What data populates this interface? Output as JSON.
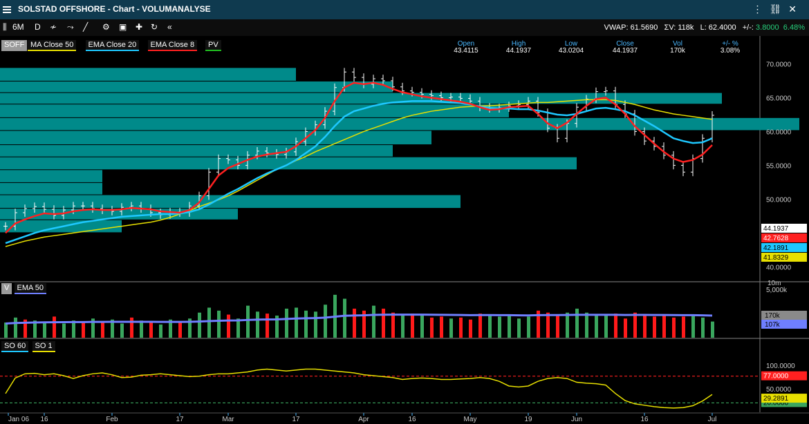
{
  "window": {
    "title": "SOLSTAD OFFSHORE - Chart - VOLUMANALYSE"
  },
  "toolbar": {
    "period": "6M",
    "interval": "D",
    "collapse": "«"
  },
  "stats": {
    "vwap": "VWAP: 61.5690",
    "sum_vol": "ΣV: 118k",
    "last": "L: 62.4000",
    "change_label": "+/-:",
    "change": "3.8000",
    "change_pct": "6.48%"
  },
  "ohlc": {
    "labels": [
      "Open",
      "High",
      "Low",
      "Close",
      "Vol",
      "+/- %"
    ],
    "values": [
      "43.4115",
      "44.1937",
      "43.0204",
      "44.1937",
      "170k",
      "3.08%"
    ]
  },
  "legend_price": [
    {
      "label": "SOFF",
      "color": "#9a9a9a",
      "fill": true
    },
    {
      "label": "MA Close 50",
      "color": "#e8e000"
    },
    {
      "label": "EMA Close 20",
      "color": "#1ec8ff"
    },
    {
      "label": "EMA Close 8",
      "color": "#ff2020"
    },
    {
      "label": "PV",
      "color": "#20c020"
    }
  ],
  "legend_vol": [
    {
      "label": "V",
      "color": "#9a9a9a",
      "fill": true
    },
    {
      "label": "EMA 50",
      "color": "#6f7fff"
    }
  ],
  "legend_so": [
    {
      "label": "SO 60",
      "color": "#1ec8ff"
    },
    {
      "label": "SO 1",
      "color": "#e8e000"
    }
  ],
  "colors": {
    "accent": "#0f3a4f",
    "profile": "#008a8a",
    "ma50": "#e8e000",
    "ema20": "#1ec8ff",
    "ema8": "#ff2020",
    "vol_up": "#3aa65e",
    "vol_down": "#ff1a1a",
    "vol_ema": "#6f7fff",
    "so": "#e8e000",
    "so_upper": "#ff2020",
    "so_lower": "#3aa65e"
  },
  "chart_data": [
    {
      "type": "line",
      "panel": "price",
      "ylim": [
        38.2,
        72.5
      ],
      "y_ticks": [
        "70.0000",
        "65.0000",
        "60.0000",
        "55.0000",
        "50.0000",
        "40.0000"
      ],
      "x_ticks": [
        "Jan 06",
        "16",
        "Feb",
        "17",
        "Mar",
        "17",
        "Apr",
        "16",
        "May",
        "19",
        "Jun",
        "16",
        "Jul"
      ],
      "price_tags": [
        {
          "value": "44.1937",
          "bg": "#ffffff",
          "fg": "#000000"
        },
        {
          "value": "42.7628",
          "bg": "#ff2020",
          "fg": "#ffffff"
        },
        {
          "value": "42.1891",
          "bg": "#1ec8ff",
          "fg": "#000000"
        },
        {
          "value": "41.8329",
          "bg": "#e8e000",
          "fg": "#000000"
        }
      ],
      "price_close": [
        46.0,
        48.0,
        48.6,
        48.9,
        48.5,
        47.6,
        48.4,
        49.0,
        49.0,
        48.6,
        48.4,
        48.2,
        48.8,
        49.0,
        48.6,
        48.0,
        47.7,
        48.1,
        48.0,
        49.0,
        50.5,
        54.0,
        56.0,
        55.8,
        55.0,
        56.5,
        57.1,
        56.8,
        56.6,
        57.0,
        58.5,
        60.0,
        61.0,
        63.0,
        66.5,
        68.8,
        68.0,
        67.0,
        67.8,
        67.5,
        66.6,
        66.0,
        65.8,
        65.5,
        65.3,
        65.0,
        65.1,
        64.9,
        64.5,
        63.6,
        63.4,
        63.5,
        63.8,
        64.0,
        64.5,
        62.8,
        60.5,
        59.0,
        61.2,
        63.6,
        64.8,
        65.9,
        66.0,
        64.0,
        62.6,
        60.0,
        58.6,
        57.8,
        56.5,
        55.0,
        54.0,
        56.0,
        59.0,
        62.4
      ],
      "series": [
        {
          "key": "ma50",
          "values": [
            43.0,
            43.4,
            43.8,
            44.1,
            44.4,
            44.6,
            44.8,
            45.0,
            45.2,
            45.4,
            45.6,
            45.8,
            46.0,
            46.2,
            46.4,
            46.6,
            46.9,
            47.3,
            47.8,
            48.3,
            48.9,
            49.4,
            49.9,
            50.5,
            51.2,
            52.0,
            52.8,
            53.6,
            54.4,
            55.0,
            55.7,
            56.3,
            57.0,
            57.6,
            58.2,
            58.8,
            59.4,
            60.0,
            60.5,
            61.0,
            61.5,
            62.0,
            62.4,
            62.7,
            63.0,
            63.2,
            63.4,
            63.6,
            63.7,
            63.8,
            63.8,
            63.9,
            64.0,
            64.1,
            64.2,
            64.3,
            64.3,
            64.4,
            64.5,
            64.6,
            64.7,
            64.7,
            64.7,
            64.6,
            64.3,
            64.0,
            63.6,
            63.2,
            62.9,
            62.6,
            62.4,
            62.2,
            62.0,
            61.8
          ]
        },
        {
          "key": "ema20",
          "values": [
            43.5,
            44.0,
            44.5,
            45.0,
            45.4,
            45.7,
            46.0,
            46.3,
            46.6,
            46.8,
            47.0,
            47.2,
            47.4,
            47.5,
            47.6,
            47.7,
            47.8,
            47.8,
            47.9,
            48.1,
            48.5,
            49.2,
            50.0,
            50.8,
            51.5,
            52.3,
            53.1,
            53.8,
            54.4,
            55.0,
            55.8,
            56.8,
            57.8,
            59.2,
            60.8,
            62.2,
            63.0,
            63.4,
            63.8,
            64.1,
            64.3,
            64.4,
            64.5,
            64.5,
            64.5,
            64.4,
            64.3,
            64.2,
            64.0,
            63.7,
            63.5,
            63.4,
            63.4,
            63.3,
            63.3,
            63.1,
            62.8,
            62.5,
            62.4,
            62.6,
            63.0,
            63.4,
            63.5,
            63.3,
            63.0,
            62.4,
            61.6,
            60.8,
            59.9,
            59.0,
            58.6,
            58.3,
            58.4,
            59.0
          ]
        },
        {
          "key": "ema8",
          "values": [
            45.0,
            46.4,
            47.0,
            47.5,
            47.9,
            47.8,
            47.9,
            48.2,
            48.4,
            48.5,
            48.4,
            48.4,
            48.5,
            48.7,
            48.6,
            48.5,
            48.2,
            48.1,
            48.0,
            48.4,
            49.5,
            51.5,
            53.5,
            54.6,
            55.2,
            55.8,
            56.3,
            56.6,
            56.8,
            57.0,
            57.8,
            59.0,
            60.2,
            62.0,
            64.5,
            66.5,
            67.2,
            67.0,
            67.2,
            66.9,
            66.3,
            65.8,
            65.5,
            65.2,
            65.0,
            64.8,
            64.6,
            64.4,
            64.1,
            63.6,
            63.2,
            63.3,
            63.6,
            63.7,
            63.8,
            62.6,
            61.2,
            60.5,
            61.3,
            62.6,
            63.8,
            64.8,
            65.0,
            64.0,
            62.6,
            60.8,
            59.5,
            58.2,
            57.0,
            56.0,
            55.5,
            55.8,
            56.6,
            58.0
          ]
        }
      ],
      "volume_profile": [
        {
          "low": 67.4,
          "high": 69.4,
          "end_index": 30
        },
        {
          "low": 65.7,
          "high": 67.4,
          "end_index": 40
        },
        {
          "low": 64.0,
          "high": 65.7,
          "end_index": 74
        },
        {
          "low": 62.0,
          "high": 64.0,
          "end_index": 52
        },
        {
          "low": 60.1,
          "high": 62.0,
          "end_index": 82
        },
        {
          "low": 58.0,
          "high": 60.1,
          "end_index": 44
        },
        {
          "low": 56.2,
          "high": 58.0,
          "end_index": 40
        },
        {
          "low": 54.3,
          "high": 56.2,
          "end_index": 59
        },
        {
          "low": 52.4,
          "high": 54.3,
          "end_index": 10
        },
        {
          "low": 50.6,
          "high": 52.4,
          "end_index": 10
        },
        {
          "low": 48.6,
          "high": 50.6,
          "end_index": 47
        },
        {
          "low": 46.9,
          "high": 48.6,
          "end_index": 24
        },
        {
          "low": 45.0,
          "high": 46.9,
          "end_index": 12
        }
      ]
    },
    {
      "type": "bar",
      "panel": "volume",
      "scale_label": "10m",
      "y_ticks": [
        "5,000k"
      ],
      "tags": [
        {
          "value": "170k",
          "bg": "#8a8a8a",
          "fg": "#000000"
        },
        {
          "value": "107k",
          "bg": "#6f7fff",
          "fg": "#000000"
        }
      ],
      "values": [
        160,
        210,
        190,
        180,
        170,
        220,
        150,
        180,
        160,
        200,
        170,
        190,
        150,
        210,
        180,
        160,
        140,
        190,
        170,
        200,
        260,
        310,
        280,
        240,
        200,
        330,
        270,
        250,
        230,
        300,
        310,
        280,
        270,
        340,
        440,
        400,
        300,
        280,
        330,
        300,
        260,
        240,
        250,
        230,
        210,
        220,
        200,
        210,
        190,
        250,
        230,
        220,
        240,
        200,
        220,
        280,
        260,
        240,
        260,
        300,
        260,
        240,
        230,
        250,
        200,
        260,
        240,
        220,
        230,
        210,
        220,
        230,
        210,
        170
      ],
      "up": [
        1,
        1,
        0,
        1,
        1,
        0,
        1,
        1,
        0,
        1,
        0,
        1,
        1,
        0,
        1,
        0,
        1,
        1,
        0,
        1,
        1,
        1,
        1,
        0,
        1,
        1,
        1,
        0,
        1,
        1,
        1,
        1,
        1,
        1,
        1,
        1,
        0,
        0,
        1,
        0,
        0,
        1,
        0,
        1,
        0,
        0,
        1,
        0,
        0,
        0,
        1,
        1,
        1,
        1,
        1,
        0,
        0,
        0,
        1,
        1,
        1,
        1,
        1,
        0,
        0,
        0,
        0,
        0,
        0,
        0,
        0,
        1,
        1,
        1
      ],
      "ema": [
        150,
        155,
        158,
        160,
        162,
        163,
        164,
        165,
        165,
        166,
        166,
        167,
        167,
        167,
        167,
        167,
        166,
        166,
        166,
        167,
        170,
        174,
        178,
        180,
        181,
        186,
        189,
        191,
        192,
        196,
        200,
        203,
        205,
        209,
        219,
        228,
        231,
        233,
        237,
        239,
        240,
        240,
        240,
        240,
        239,
        238,
        237,
        236,
        234,
        235,
        235,
        234,
        234,
        233,
        232,
        234,
        235,
        235,
        236,
        238,
        238,
        238,
        238,
        238,
        236,
        237,
        237,
        236,
        236,
        235,
        234,
        234,
        233,
        230
      ]
    },
    {
      "type": "line",
      "panel": "stochastic",
      "ylim": [
        0,
        110
      ],
      "y_ticks": [
        "100.0000",
        "50.0000"
      ],
      "levels": [
        {
          "value": 77,
          "label": "77.0000",
          "color": "#ff2020",
          "fg": "#ffffff"
        },
        {
          "value": 20,
          "label": "20.0000",
          "color": "#3aa65e",
          "fg": "#000000"
        }
      ],
      "current": {
        "value": 29.3,
        "label": "29.2891",
        "bg": "#e8e000",
        "fg": "#000000"
      },
      "series": [
        {
          "key": "so",
          "values": [
            40,
            73,
            82,
            83,
            80,
            82,
            78,
            72,
            78,
            82,
            84,
            80,
            74,
            75,
            79,
            80,
            82,
            80,
            78,
            76,
            77,
            80,
            82,
            82,
            84,
            86,
            90,
            92,
            90,
            88,
            90,
            92,
            92,
            90,
            88,
            86,
            84,
            80,
            78,
            76,
            74,
            70,
            72,
            73,
            72,
            70,
            70,
            71,
            72,
            74,
            72,
            66,
            56,
            54,
            56,
            66,
            72,
            74,
            72,
            64,
            62,
            61,
            58,
            40,
            25,
            18,
            15,
            12,
            10,
            9,
            10,
            14,
            24,
            38
          ]
        }
      ]
    }
  ]
}
